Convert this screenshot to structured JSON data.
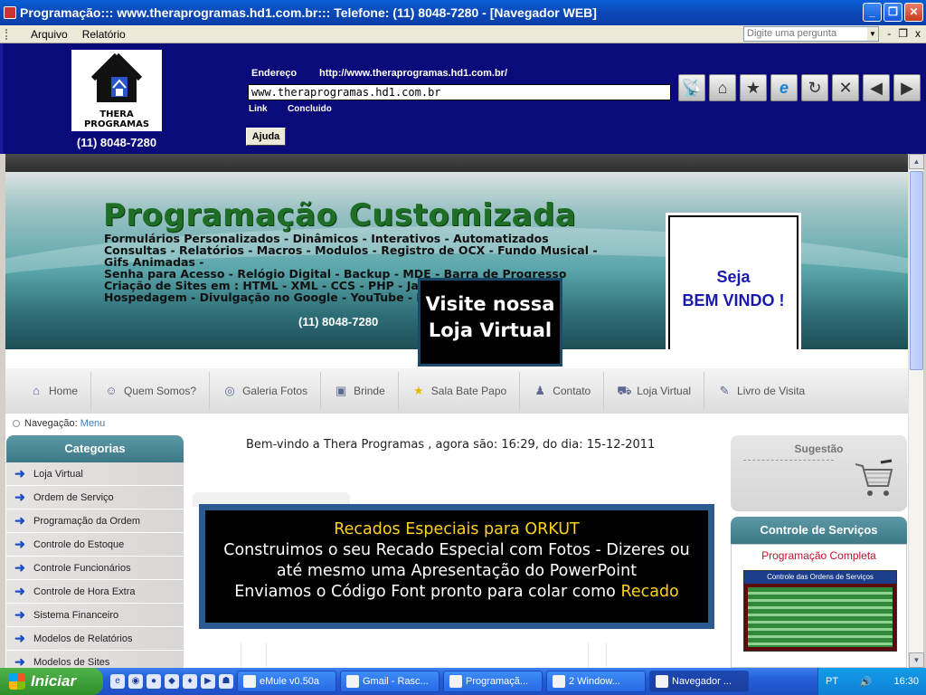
{
  "window": {
    "title": "Programação::: www.theraprogramas.hd1.com.br::: Telefone: (11) 8048-7280 - [Navegador WEB]",
    "min": "_",
    "max": "❐",
    "close": "✕"
  },
  "menubar": {
    "items": [
      "Arquivo",
      "Relatório"
    ],
    "ask_placeholder": "Digite uma pergunta",
    "mdi": [
      "-",
      "❐",
      "x"
    ]
  },
  "toppanel": {
    "logo_text_1": "THERA",
    "logo_text_2": "PROGRAMAS",
    "phone": "(11) 8048-7280",
    "endereco_label": "Endereço",
    "endereco_url": "http://www.theraprogramas.hd1.com.br/",
    "address_value": "www.theraprogramas.hd1.com.br",
    "link_label": "Link",
    "status": "Concluido",
    "help_button": "Ajuda",
    "nav_icons": [
      "satellite-icon",
      "home-icon",
      "favorites-icon",
      "ie-icon",
      "refresh-icon",
      "stop-icon",
      "back-icon",
      "forward-icon"
    ]
  },
  "banner": {
    "title": "Programação Customizada",
    "lines": [
      "Formulários Personalizados - Dinâmicos - Interativos - Automatizados",
      "Consultas - Relatórios - Macros - Modulos - Registro de OCX - Fundo Musical -",
      "Gifs Animadas -",
      "Senha para Acesso - Relógio Digital - Backup - MDE - Barra de Progresso",
      "Criação de Sites em : HTML - XML - CCS - PHP - Javascript - Flash - CS4",
      "Hospedagem - Divulgação no Google - YouTube - Marketing"
    ],
    "phone": "(11) 8048-7280",
    "visite_1": "Visite nossa",
    "visite_2": "Loja Virtual",
    "seja": "Seja",
    "bem_vindo": "BEM VINDO !"
  },
  "topnav": [
    {
      "label": "Home",
      "icon": "⌂"
    },
    {
      "label": "Quem Somos?",
      "icon": "☺"
    },
    {
      "label": "Galeria Fotos",
      "icon": "◎"
    },
    {
      "label": "Brinde",
      "icon": "▣"
    },
    {
      "label": "Sala Bate Papo",
      "icon": "★"
    },
    {
      "label": "Contato",
      "icon": "♟"
    },
    {
      "label": "Loja Virtual",
      "icon": "⛟"
    },
    {
      "label": "Livro de Visita",
      "icon": "✎"
    }
  ],
  "breadcrumb": {
    "label": "Navegação:",
    "link": "Menu"
  },
  "categories": {
    "title": "Categorias",
    "items": [
      "Loja Virtual",
      "Ordem de Serviço",
      "Programação da Ordem",
      "Controle do Estoque",
      "Controle Funcionários",
      "Controle de Hora Extra",
      "Sistema Financeiro",
      "Modelos de Relatórios",
      "Modelos de Sites"
    ]
  },
  "main": {
    "welcome": "Bem-vindo a Thera Programas , agora são: 16:29, do dia: 15-12-2011",
    "orkut_title": "Recados Especiais para ORKUT",
    "orkut_line_2": "Construimos o seu Recado Especial com Fotos - Dizeres ou",
    "orkut_line_3": "até mesmo uma Apresentação do PowerPoint",
    "orkut_line_4a": "Enviamos o Código Font pronto para colar como",
    "orkut_line_4b": "Recado"
  },
  "right": {
    "sugestao": "Sugestão",
    "cs_title": "Controle de Serviços",
    "cs_sub": "Programação Completa",
    "cs_thumb_title": "Controle das Ordens de Serviços"
  },
  "taskbar": {
    "start": "Iniciar",
    "tasks": [
      "eMule v0.50a",
      "Gmail - Rasc...",
      "Programaçã...",
      "2 Window...",
      "Navegador ..."
    ],
    "lang": "PT",
    "time": "16:30"
  },
  "colors": {
    "panel_bg": "#0a0a7a",
    "accent_teal": "#4a8896",
    "banner_title_green": "#1f6e26",
    "yellow": "#ffd21a"
  }
}
